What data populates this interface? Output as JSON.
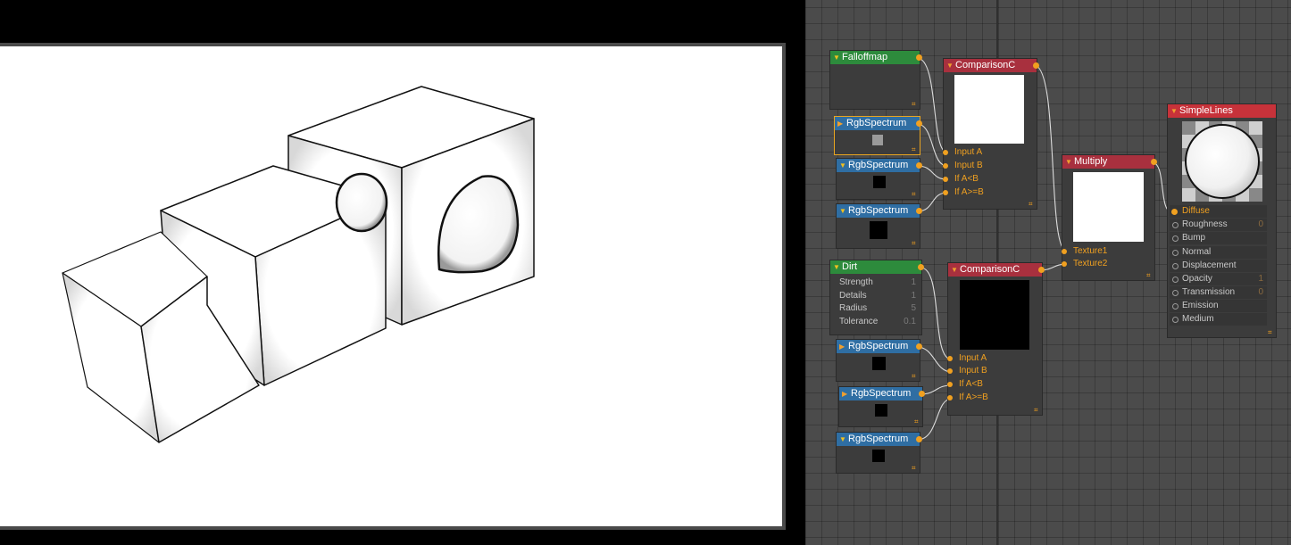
{
  "nodes": {
    "falloffmap": {
      "title": "Falloffmap"
    },
    "rgb1": {
      "title": "RgbSpectrum"
    },
    "rgb2": {
      "title": "RgbSpectrum"
    },
    "rgb3": {
      "title": "RgbSpectrum"
    },
    "comparison1": {
      "title": "ComparisonC",
      "inputs": [
        "Input A",
        "Input B",
        "If A<B",
        "If A>=B"
      ]
    },
    "dirt": {
      "title": "Dirt",
      "params": [
        {
          "label": "Strength",
          "value": "1"
        },
        {
          "label": "Details",
          "value": "1"
        },
        {
          "label": "Radius",
          "value": "5"
        },
        {
          "label": "Tolerance",
          "value": "0.1"
        }
      ]
    },
    "rgb4": {
      "title": "RgbSpectrum"
    },
    "rgb5": {
      "title": "RgbSpectrum"
    },
    "rgb6": {
      "title": "RgbSpectrum"
    },
    "comparison2": {
      "title": "ComparisonC",
      "inputs": [
        "Input A",
        "Input B",
        "If A<B",
        "If A>=B"
      ]
    },
    "multiply": {
      "title": "Multiply",
      "inputs": [
        "Texture1",
        "Texture2"
      ]
    },
    "simplelines": {
      "title": "SimpleLines",
      "params": [
        {
          "label": "Diffuse",
          "value": ""
        },
        {
          "label": "Roughness",
          "value": "0"
        },
        {
          "label": "Bump",
          "value": ""
        },
        {
          "label": "Normal",
          "value": ""
        },
        {
          "label": "Displacement",
          "value": ""
        },
        {
          "label": "Opacity",
          "value": "1"
        },
        {
          "label": "Transmission",
          "value": "0"
        },
        {
          "label": "Emission",
          "value": ""
        },
        {
          "label": "Medium",
          "value": ""
        }
      ]
    }
  },
  "swatch_colors": {
    "gray": "#9a9a9a",
    "black": "#000000",
    "white": "#ffffff"
  },
  "accent": "#f0a020"
}
